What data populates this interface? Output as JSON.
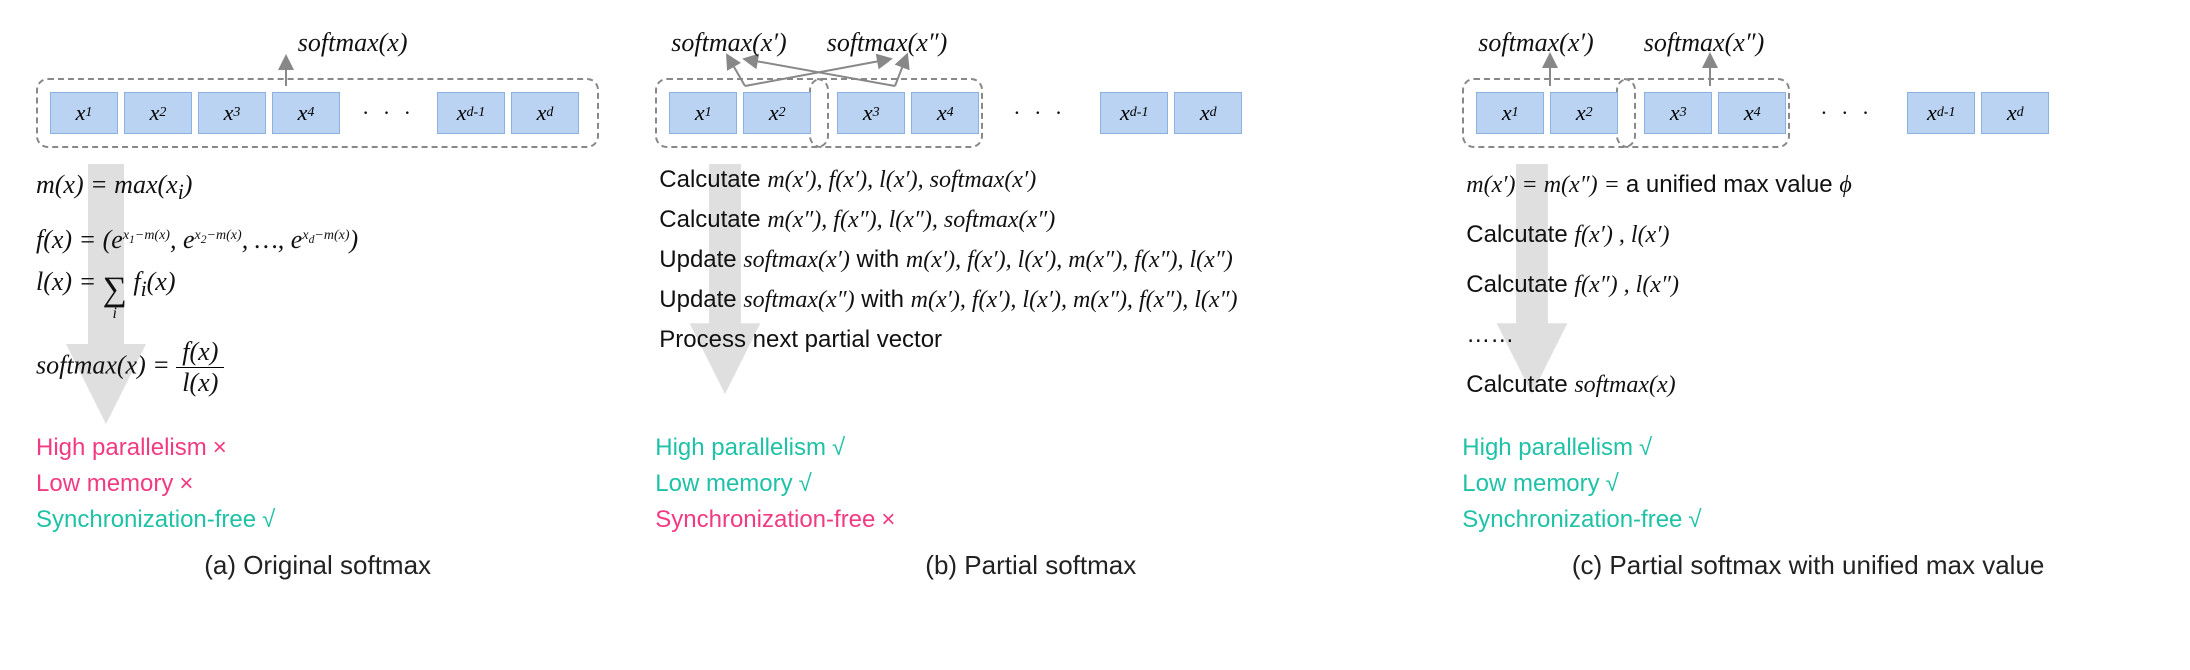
{
  "panels": {
    "a": {
      "output": "softmax(x)",
      "cells": [
        "x₁",
        "x₂",
        "x₃",
        "x₄",
        "…",
        "x_{d-1}",
        "x_d"
      ],
      "formulas": {
        "m": "m(x) = max(xᵢ)",
        "f": "f(x) = (e^{x₁−m(x)}, e^{x₂−m(x)}, …, e^{x_d−m(x)})",
        "l": "l(x) = Σᵢ fᵢ(x)",
        "s": "softmax(x) = f(x) / l(x)"
      },
      "props": [
        {
          "text": "High parallelism",
          "ok": false
        },
        {
          "text": "Low memory",
          "ok": false
        },
        {
          "text": "Synchronization-free",
          "ok": true
        }
      ],
      "caption": "(a) Original softmax"
    },
    "b": {
      "outputs": [
        "softmax(x′)",
        "softmax(x″)"
      ],
      "cells": [
        "x₁",
        "x₂",
        "x₃",
        "x₄",
        "…",
        "x_{d-1}",
        "x_d"
      ],
      "steps": {
        "s1": "Calcutate m(x′), f(x′), l(x′), softmax(x′)",
        "s2": "Calcutate m(x″), f(x″), l(x″), softmax(x″)",
        "s3": "Update softmax(x′) with m(x′), f(x′), l(x′), m(x″), f(x″), l(x″)",
        "s4": "Update softmax(x″) with m(x′), f(x′), l(x′), m(x″), f(x″), l(x″)",
        "s5": "Process next partial vector"
      },
      "props": [
        {
          "text": "High parallelism",
          "ok": true
        },
        {
          "text": "Low memory",
          "ok": true
        },
        {
          "text": "Synchronization-free",
          "ok": false
        }
      ],
      "caption": "(b) Partial softmax"
    },
    "c": {
      "outputs": [
        "softmax(x′)",
        "softmax(x″)"
      ],
      "cells": [
        "x₁",
        "x₂",
        "x₃",
        "x₄",
        "…",
        "x_{d-1}",
        "x_d"
      ],
      "steps": {
        "s1": "m(x′) = m(x″) = a unified max value ϕ",
        "s2": "Calcutate f(x′) , l(x′)",
        "s3": "Calcutate f(x″) , l(x″)",
        "s4": "……",
        "s5": "Calcutate softmax(x)"
      },
      "props": [
        {
          "text": "High parallelism",
          "ok": true
        },
        {
          "text": "Low memory",
          "ok": true
        },
        {
          "text": "Synchronization-free",
          "ok": true
        }
      ],
      "caption": "(c) Partial softmax with unified max value"
    }
  },
  "marks": {
    "yes": "√",
    "no": "×"
  },
  "cell_labels": {
    "x1": "x",
    "x1s": "1",
    "x2": "x",
    "x2s": "2",
    "x3": "x",
    "x3s": "3",
    "x4": "x",
    "x4s": "4",
    "xd1": "x",
    "xd1s": "d-1",
    "xd": "x",
    "xds": "d",
    "dots": "· · ·"
  }
}
